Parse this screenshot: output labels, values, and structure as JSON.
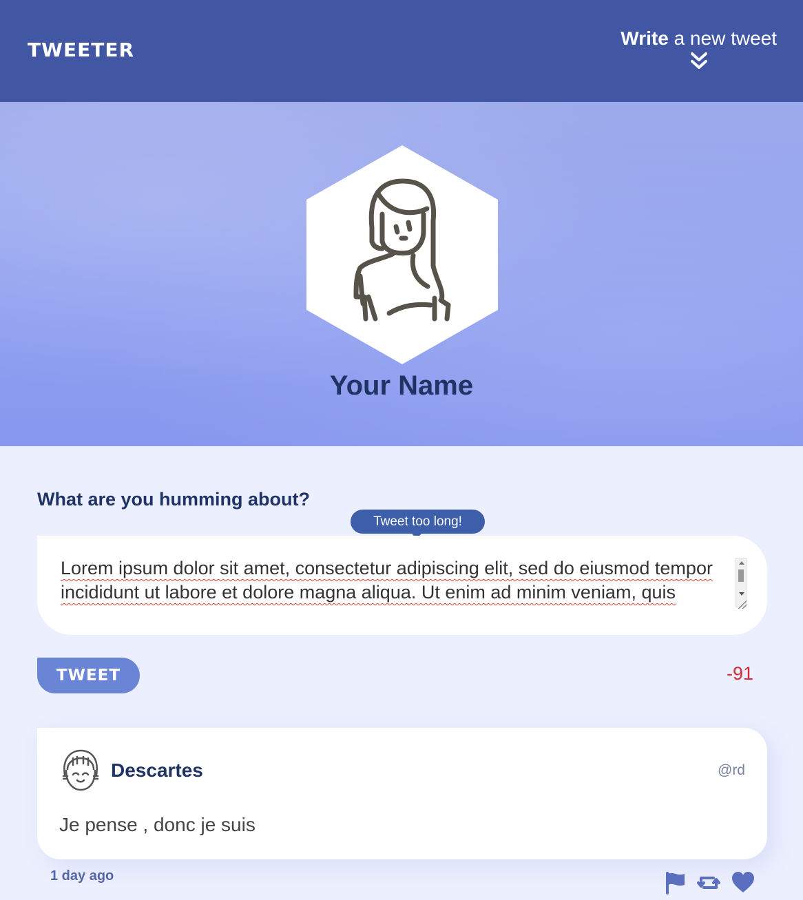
{
  "nav": {
    "brand": "TWEETER",
    "write_bold": "Write",
    "write_rest": " a new tweet",
    "icon": "double-chevron-down-icon"
  },
  "profile": {
    "name": "Your Name",
    "avatar_icon": "user-avatar-icon"
  },
  "compose": {
    "label": "What are you humming about?",
    "tooltip": "Tweet too long!",
    "text": "Lorem ipsum dolor sit amet, consectetur adipiscing elit, sed do eiusmod tempor incididunt ut labore et dolore magna aliqua. Ut enim ad minim veniam, quis",
    "button_label": "TWEET",
    "counter": "-91"
  },
  "tweets": [
    {
      "author": "Descartes",
      "handle": "@rd",
      "text": "Je pense , donc je suis",
      "time": "1 day ago"
    }
  ],
  "colors": {
    "nav": "#4157a3",
    "banner": "#8f9ff0",
    "page": "#eceffd",
    "accent": "#6b85d6",
    "error": "#d42a3a"
  }
}
